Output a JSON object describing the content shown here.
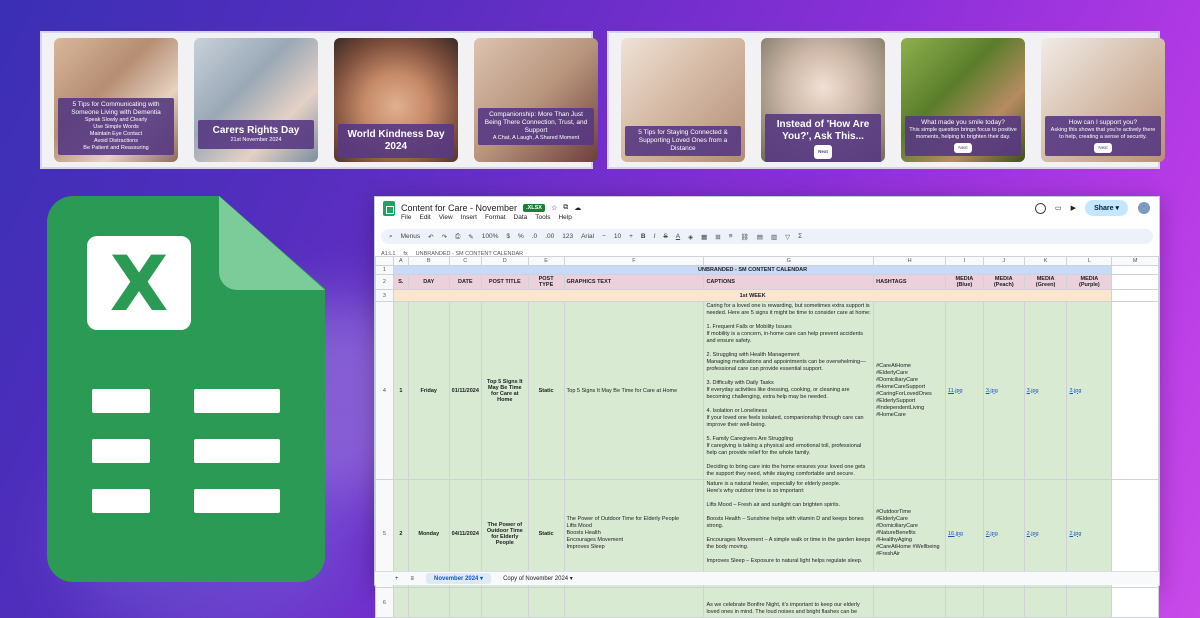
{
  "posts_left": [
    {
      "title": "5 Tips for Communicating with Someone Living with Dementia",
      "lines": [
        "Speak Slowly and Clearly",
        "Use Simple Words",
        "Maintain Eye Contact",
        "Avoid Distractions",
        "Be Patient and Reassuring"
      ]
    },
    {
      "title": "Carers Rights Day",
      "subtitle": "21st November 2024"
    },
    {
      "title": "World Kindness Day 2024"
    },
    {
      "title": "Companionship: More Than Just Being There Connection, Trust, and Support",
      "subtitle": "A Chat, A Laugh, A Shared Moment"
    }
  ],
  "posts_right": [
    {
      "title": "5 Tips for Staying Connected & Supporting Loved Ones from a Distance"
    },
    {
      "title": "Instead of 'How Are You?', Ask This...",
      "button": "Next"
    },
    {
      "title": "What made you smile today?",
      "subtitle": "This simple question brings focus to positive moments, helping to brighten their day.",
      "button": "Next"
    },
    {
      "title": "How can I support you?",
      "subtitle": "Asking this shows that you're actively there to help, creating a sense of security.",
      "button": "Next"
    }
  ],
  "sheet": {
    "doc_title": "Content for Care - November",
    "badge": ".XLSX",
    "menu": [
      "File",
      "Edit",
      "View",
      "Insert",
      "Format",
      "Data",
      "Tools",
      "Help"
    ],
    "share_label": "Share",
    "toolbar": {
      "menus": "Menus",
      "zoom": "100%",
      "font": "Arial",
      "font_size": "10",
      "currency": "$",
      "percent": "%",
      "dec": ".0",
      "dec2": ".00",
      "num": "123"
    },
    "cell_ref": "A1:L1",
    "formula": "UNBRANDED - SM CONTENT CALENDAR",
    "columns": [
      "A",
      "B",
      "C",
      "D",
      "E",
      "F",
      "G",
      "H",
      "I",
      "J",
      "K",
      "L",
      "M"
    ],
    "banner": "UNBRANDED - SM CONTENT CALENDAR",
    "headers": [
      "S.",
      "DAY",
      "DATE",
      "POST TITLE",
      "POST TYPE",
      "GRAPHICS TEXT",
      "CAPTIONS",
      "HASHTAGS",
      "MEDIA (Blue)",
      "MEDIA (Peach)",
      "MEDIA (Green)",
      "MEDIA (Purple)"
    ],
    "week_label": "1st WEEK",
    "rows": [
      {
        "rownum": "4",
        "s": "1",
        "day": "Friday",
        "date": "01/11/2024",
        "title": "Top 5 Signs It May Be Time for Care at Home",
        "type": "Static",
        "graphics": "Top 5 Signs It May Be Time for Care at Home",
        "caption": "Caring for a loved one is rewarding, but sometimes extra support is needed. Here are 5 signs it might be time to consider care at home:\n\n1. Frequent Falls or Mobility Issues\nIf mobility is a concern, in-home care can help prevent accidents and ensure safety.\n\n2. Struggling with Health Management\nManaging medications and appointments can be overwhelming—professional care can provide essential support.\n\n3. Difficulty with Daily Tasks\nIf everyday activities like dressing, cooking, or cleaning are becoming challenging, extra help may be needed.\n\n4. Isolation or Loneliness\nIf your loved one feels isolated, companionship through care can improve their well-being.\n\n5. Family Caregivers Are Struggling\nIf caregiving is taking a physical and emotional toll, professional help can provide relief for the whole family.\n\nDeciding to bring care into the home ensures your loved one gets the support they need, while staying comfortable and secure.",
        "hashtags": "#CareAtHome\n#ElderlyCare\n#DomiciliaryCare\n#HomeCareSupport\n#CaringForLovedOnes\n#ElderlySupport\n#IndependentLiving\n#HomeCare",
        "m1": "11.jpg",
        "m2": "3.jpg",
        "m3": "3.jpg",
        "m4": "3.jpg"
      },
      {
        "rownum": "5",
        "s": "2",
        "day": "Monday",
        "date": "04/11/2024",
        "title": "The Power of Outdoor Time for Elderly People",
        "type": "Static",
        "graphics": "The Power of Outdoor Time for Elderly People\nLifts Mood\nBoosts Health\nEncourages Movement\nImproves Sleep",
        "caption": "Nature is a natural healer, especially for elderly people.\nHere's why outdoor time is so important:\n\nLifts Mood – Fresh air and sunlight can brighten spirits.\n\nBoosts Health – Sunshine helps with vitamin D and keeps bones strong.\n\nEncourages Movement – A simple walk or time in the garden keeps the body moving.\n\nImproves Sleep – Exposure to natural light helps regulate sleep.\n\nEven a few minutes outside can make a world of difference. How does your loved one enjoy time in nature?",
        "hashtags": "#OutdoorTime\n#ElderlyCare\n#DomiciliaryCare\n#NatureBenefits\n#HealthyAging\n#CareAtHome #Wellbeing\n#FreshAir",
        "m1": "16.jpg",
        "m2": "2.jpg",
        "m3": "2.jpg",
        "m4": "2.jpg"
      },
      {
        "rownum": "6",
        "caption": "As we celebrate Bonfire Night, it's important to keep our elderly loved ones in mind. The loud noises and bright flashes can be"
      }
    ],
    "tabs": [
      "November 2024",
      "Copy of November 2024"
    ]
  },
  "colors": {
    "excel_green": "#2a9a55",
    "banner_blue": "#c9daf8",
    "header_pink": "#ead1dc",
    "week_peach": "#fce5cd",
    "row_green": "#d9ead3",
    "post_purple": "#563882"
  }
}
